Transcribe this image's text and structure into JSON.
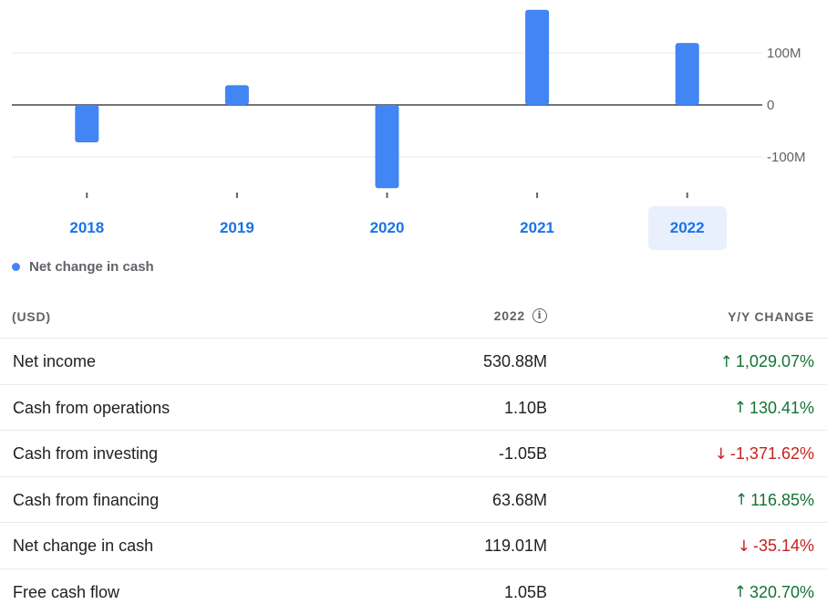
{
  "chart_data": {
    "type": "bar",
    "categories": [
      "2018",
      "2019",
      "2020",
      "2021",
      "2022"
    ],
    "series": [
      {
        "name": "Net change in cash",
        "values": [
          -72,
          38,
          -160,
          183,
          119.01
        ]
      }
    ],
    "y_ticks": [
      {
        "value": 100,
        "label": "100M"
      },
      {
        "value": 0,
        "label": "0"
      },
      {
        "value": -100,
        "label": "-100M"
      }
    ],
    "ylim": [
      -178,
      200
    ],
    "unit": "M",
    "selected_category": "2022",
    "bar_color": "#4285f4",
    "grid": true,
    "legend": "bottom-left"
  },
  "legend": {
    "label": "Net change in cash",
    "color": "#4285f4"
  },
  "table": {
    "header": {
      "currency": "(USD)",
      "period": "2022",
      "change": "Y/Y CHANGE",
      "info_icon": "info-icon"
    },
    "rows": [
      {
        "label": "Net income",
        "value": "530.88M",
        "change": "1,029.07%",
        "direction": "up"
      },
      {
        "label": "Cash from operations",
        "value": "1.10B",
        "change": "130.41%",
        "direction": "up"
      },
      {
        "label": "Cash from investing",
        "value": "-1.05B",
        "change": "-1,371.62%",
        "direction": "down"
      },
      {
        "label": "Cash from financing",
        "value": "63.68M",
        "change": "116.85%",
        "direction": "up"
      },
      {
        "label": "Net change in cash",
        "value": "119.01M",
        "change": "-35.14%",
        "direction": "down"
      },
      {
        "label": "Free cash flow",
        "value": "1.05B",
        "change": "320.70%",
        "direction": "up"
      }
    ],
    "colors": {
      "up": "#137333",
      "down": "#c5221f"
    }
  }
}
